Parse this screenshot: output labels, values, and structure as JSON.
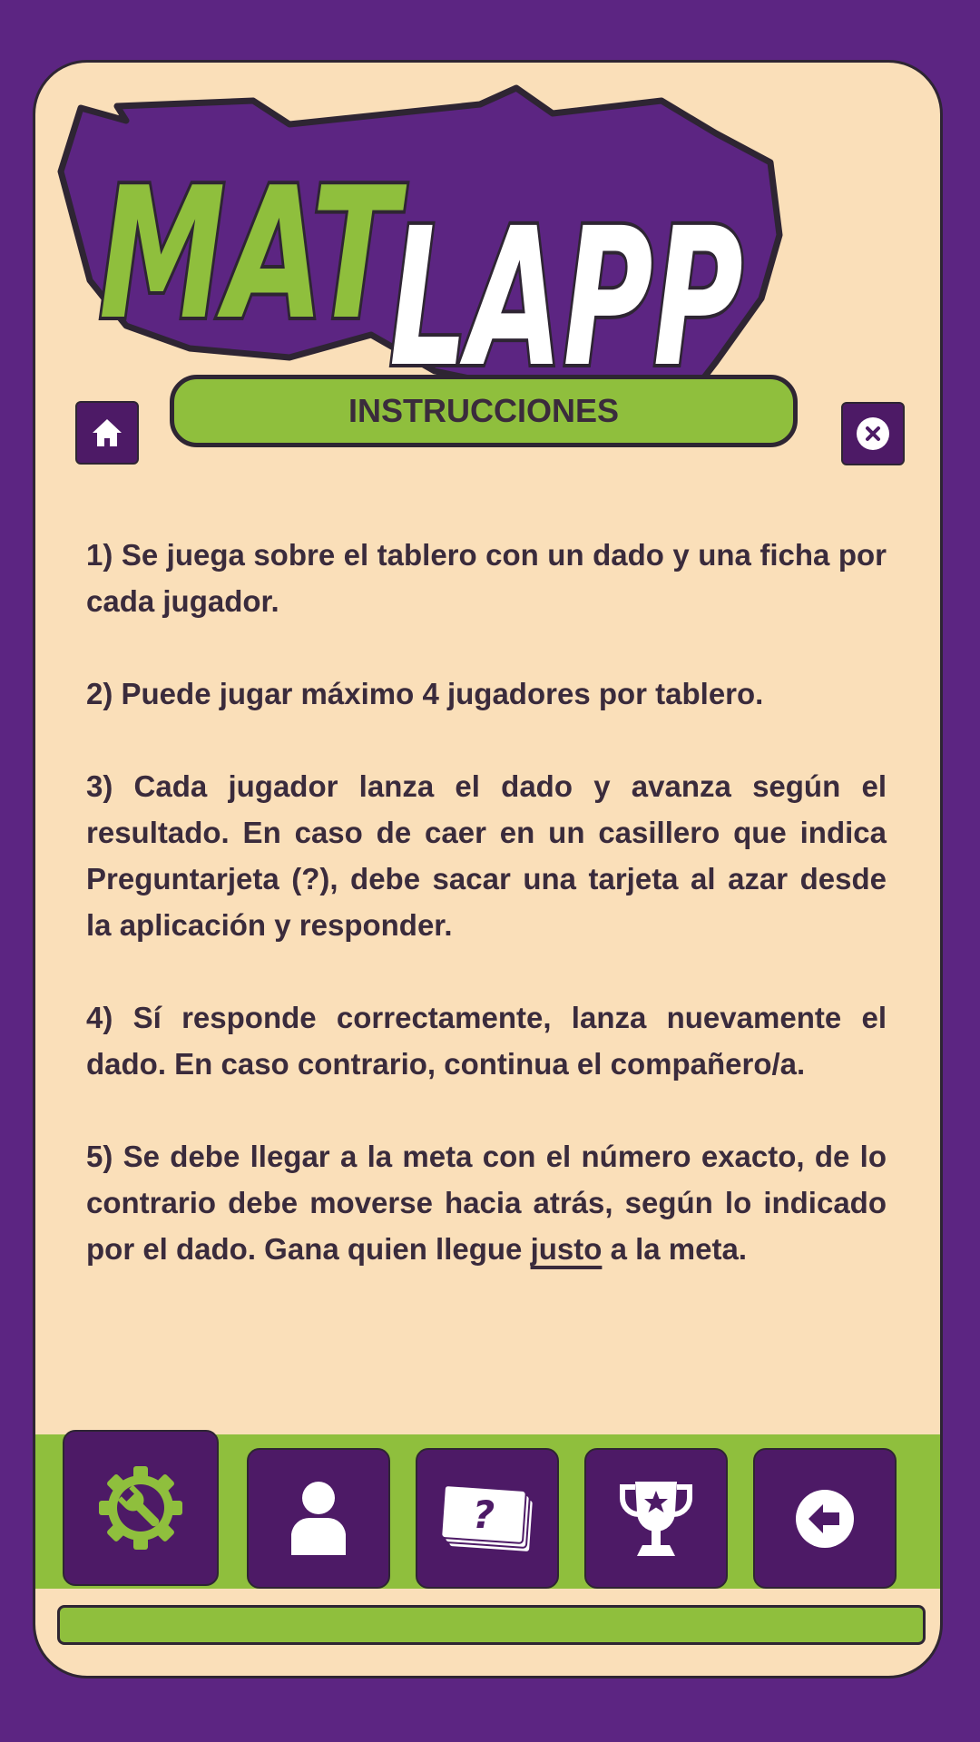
{
  "logo": {
    "part1": "MAT",
    "part2": "LAPP"
  },
  "header": {
    "title": "INSTRUCCIONES"
  },
  "instructions": [
    "1) Se juega sobre el tablero con un dado y una ficha por cada jugador.",
    "2) Puede jugar máximo 4 jugadores por tablero.",
    "3) Cada jugador lanza el dado y avanza según el resultado. En caso de caer en un casillero que indica Preguntarjeta (?), debe sacar una tarjeta al azar desde la aplicación y  responder.",
    "4) Sí responde correctamente, lanza nuevamente el dado. En caso contrario, continua el compañero/a.",
    "5) Se debe llegar a la meta con el número exacto, de lo contrario debe moverse hacia atrás, según lo indicado por el dado. Gana quien llegue "
  ],
  "instruction5_underlined": "justo",
  "instruction5_end": " a la meta.",
  "icons": {
    "home": "home-icon",
    "close": "close-icon",
    "settings": "gear-wrench-icon",
    "profile": "user-icon",
    "cards": "question-cards-icon",
    "trophy": "trophy-icon",
    "back": "back-arrow-icon"
  },
  "colors": {
    "background": "#5c2582",
    "card": "#fadfb9",
    "accent_green": "#8fbf3d",
    "button_purple": "#4d1a66",
    "text": "#3a2b3c"
  }
}
